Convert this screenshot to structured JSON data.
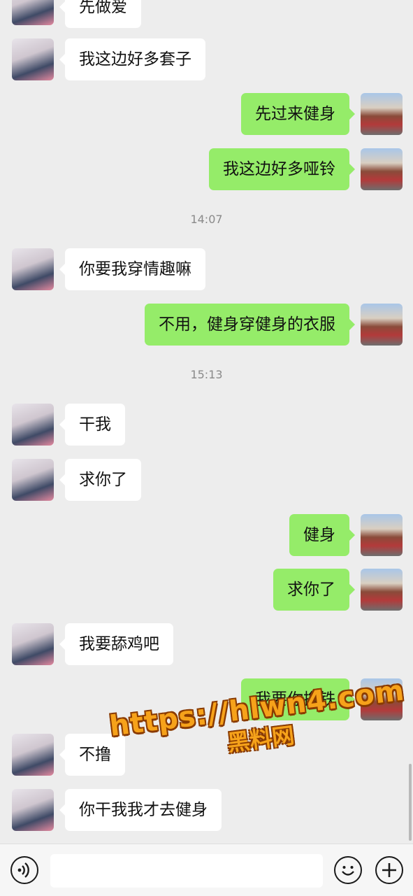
{
  "messages": [
    {
      "side": "left",
      "text": "先做爱"
    },
    {
      "side": "left",
      "text": "我这边好多套子"
    },
    {
      "side": "right",
      "text": "先过来健身"
    },
    {
      "side": "right",
      "text": "我这边好多哑铃"
    },
    {
      "side": "left",
      "text": "你要我穿情趣嘛"
    },
    {
      "side": "right",
      "text": "不用，健身穿健身的衣服"
    },
    {
      "side": "left",
      "text": "干我"
    },
    {
      "side": "left",
      "text": "求你了"
    },
    {
      "side": "right",
      "text": "健身"
    },
    {
      "side": "right",
      "text": "求你了"
    },
    {
      "side": "left",
      "text": "我要舔鸡吧"
    },
    {
      "side": "right",
      "text": "我要你撸铁"
    },
    {
      "side": "left",
      "text": "不撸"
    },
    {
      "side": "left",
      "text": "你干我我才去健身"
    }
  ],
  "timestamps": [
    "14:07",
    "15:13"
  ],
  "watermark": {
    "url": "https://hlwn4.com",
    "name": "黑料网"
  },
  "bottom_bar": {
    "voice_icon": "voice-icon",
    "emoji_icon": "emoji-icon",
    "plus_icon": "plus-icon",
    "input_value": ""
  },
  "colors": {
    "background": "#ededed",
    "sent_bubble": "#95ec69",
    "received_bubble": "#ffffff"
  }
}
